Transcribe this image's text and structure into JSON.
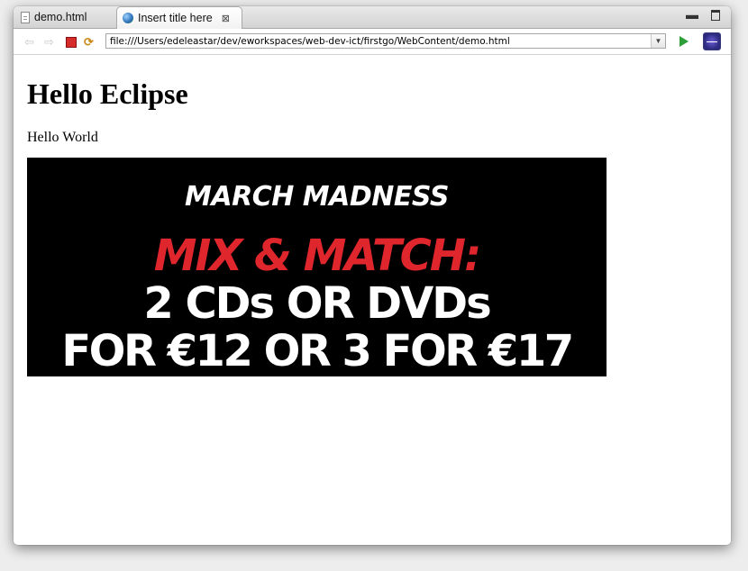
{
  "tabs": [
    {
      "label": "demo.html",
      "icon": "html-file-icon",
      "active": false
    },
    {
      "label": "Insert title here",
      "icon": "globe-icon",
      "active": true,
      "close": "⊠"
    }
  ],
  "window_controls": {
    "minimize": "▬",
    "maximize": "maximize-icon"
  },
  "toolbar": {
    "url": "file:///Users/edeleastar/dev/eworkspaces/web-dev-ict/firstgo/WebContent/demo.html",
    "dropdown": "▼"
  },
  "page": {
    "heading": "Hello Eclipse",
    "paragraph": "Hello World"
  },
  "banner": {
    "line1": "MARCH MADNESS",
    "line2": "MIX & MATCH:",
    "line3": "2 CDs OR DVDs",
    "line4": "FOR €12 OR 3 FOR €17",
    "accent_color": "#e0262d",
    "background": "#000000"
  }
}
